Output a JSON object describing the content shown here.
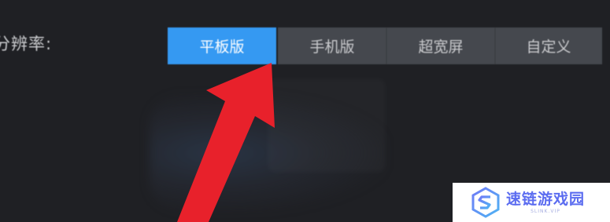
{
  "setting": {
    "label": "分辨率:"
  },
  "resolution_tabs": [
    {
      "label": "平板版",
      "active": true
    },
    {
      "label": "手机版",
      "active": false
    },
    {
      "label": "超宽屏",
      "active": false
    },
    {
      "label": "自定义",
      "active": false
    }
  ],
  "annotation": {
    "icon": "arrow-pointer-icon",
    "color": "#e8212b"
  },
  "colors": {
    "active_tab": "#3599f2",
    "inactive_tab": "#45484e",
    "background": "#1f2024"
  },
  "watermark": {
    "title": "速链游戏园",
    "subtitle": "SLINK.VIP"
  }
}
